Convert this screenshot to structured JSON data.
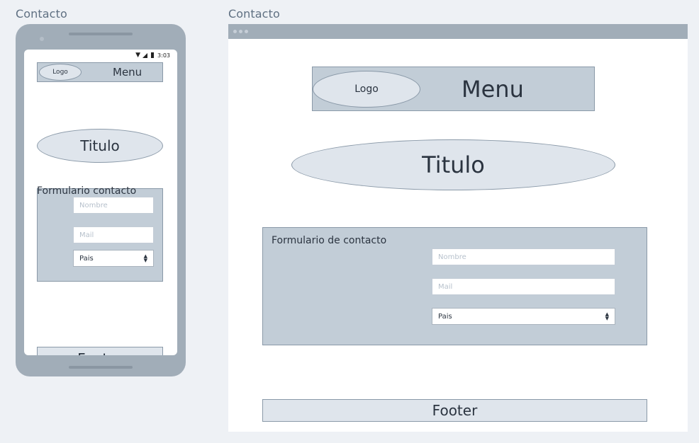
{
  "mobile": {
    "frame_title": "Contacto",
    "status_time": "3:03",
    "logo": "Logo",
    "menu": "Menu",
    "title": "Titulo",
    "form_label": "Formulario contacto",
    "name_placeholder": "Nombre",
    "mail_placeholder": "Mail",
    "country_select": "Pais",
    "footer": "Footer"
  },
  "desktop": {
    "frame_title": "Contacto",
    "logo": "Logo",
    "menu": "Menu",
    "title": "Titulo",
    "form_label": "Formulario de contacto",
    "name_placeholder": "Nombre",
    "mail_placeholder": "Mail",
    "country_select": "Pais",
    "footer": "Footer"
  },
  "colors": {
    "background": "#eef1f5",
    "device_frame": "#a1adb8",
    "block_fill": "#c2cdd7",
    "light_fill": "#dfe5ec",
    "border": "#8a99a8"
  }
}
